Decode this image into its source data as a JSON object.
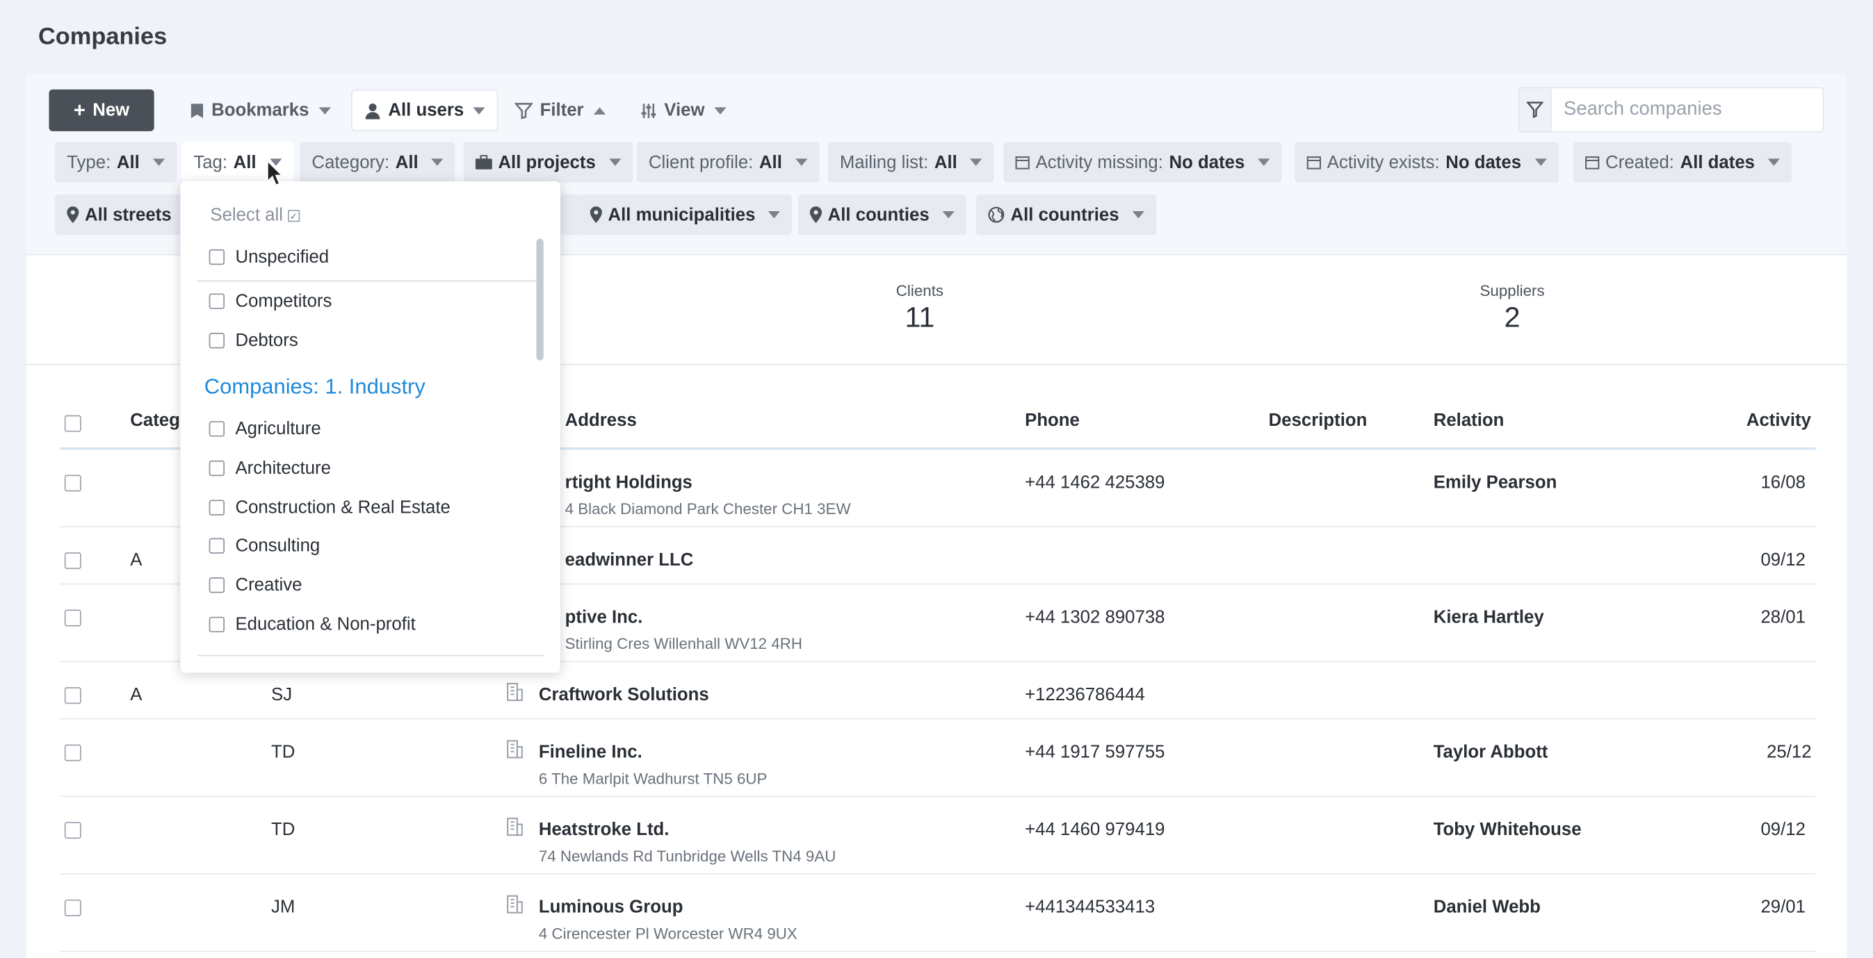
{
  "page": {
    "title": "Companies"
  },
  "toolbar": {
    "new_label": "New",
    "bookmarks_label": "Bookmarks",
    "users_label": "All users",
    "filter_label": "Filter",
    "view_label": "View"
  },
  "search": {
    "placeholder": "Search companies"
  },
  "filters": {
    "type": {
      "key": "Type:",
      "value": "All"
    },
    "tag": {
      "key": "Tag:",
      "value": "All"
    },
    "category": {
      "key": "Category:",
      "value": "All"
    },
    "projects": {
      "value": "All projects"
    },
    "client_profile": {
      "key": "Client profile:",
      "value": "All"
    },
    "mailing_list": {
      "key": "Mailing list:",
      "value": "All"
    },
    "activity_missing": {
      "key": "Activity missing:",
      "value": "No dates"
    },
    "activity_exists": {
      "key": "Activity exists:",
      "value": "No dates"
    },
    "created": {
      "key": "Created:",
      "value": "All dates"
    },
    "streets": {
      "value": "All streets"
    },
    "municipalities": {
      "value": "All municipalities"
    },
    "counties": {
      "value": "All counties"
    },
    "countries": {
      "value": "All countries"
    }
  },
  "stats": [
    {
      "label": "Clients",
      "value": "11"
    },
    {
      "label": "Suppliers",
      "value": "2"
    }
  ],
  "table": {
    "headers": {
      "category": "Categ",
      "address": "Address",
      "phone": "Phone",
      "description": "Description",
      "relation": "Relation",
      "activity": "Activity"
    },
    "rows": [
      {
        "cat": "",
        "owner": "",
        "name": "rtight Holdings",
        "address": "4 Black Diamond Park Chester CH1 3EW",
        "phone": "+44 1462 425389",
        "relation": "Emily Pearson",
        "activity": "16/08"
      },
      {
        "cat": "A",
        "owner": "",
        "name": "eadwinner LLC",
        "address": "",
        "phone": "",
        "relation": "",
        "activity": "09/12"
      },
      {
        "cat": "",
        "owner": "",
        "name": "ptive Inc.",
        "address": "Stirling Cres Willenhall WV12 4RH",
        "phone": "+44 1302 890738",
        "relation": "Kiera Hartley",
        "activity": "28/01"
      },
      {
        "cat": "A",
        "owner": "SJ",
        "name": "Craftwork Solutions",
        "address": "",
        "phone": "+12236786444",
        "relation": "",
        "activity": ""
      },
      {
        "cat": "",
        "owner": "TD",
        "name": "Fineline Inc.",
        "address": "6 The Marlpit Wadhurst TN5 6UP",
        "phone": "+44 1917 597755",
        "relation": "Taylor Abbott",
        "activity": "25/12"
      },
      {
        "cat": "",
        "owner": "TD",
        "name": "Heatstroke Ltd.",
        "address": "74 Newlands Rd Tunbridge Wells TN4 9AU",
        "phone": "+44 1460 979419",
        "relation": "Toby Whitehouse",
        "activity": "09/12"
      },
      {
        "cat": "",
        "owner": "JM",
        "name": "Luminous Group",
        "address": "4 Cirencester Pl Worcester WR4 9UX",
        "phone": "+441344533413",
        "relation": "Daniel Webb",
        "activity": "29/01"
      }
    ]
  },
  "tag_dropdown": {
    "select_all": "Select all",
    "unspecified": "Unspecified",
    "items_top": [
      "Competitors",
      "Debtors"
    ],
    "group_title": "Companies: 1. Industry",
    "group_items": [
      "Agriculture",
      "Architecture",
      "Construction & Real Estate",
      "Consulting",
      "Creative",
      "Education & Non-profit"
    ]
  }
}
